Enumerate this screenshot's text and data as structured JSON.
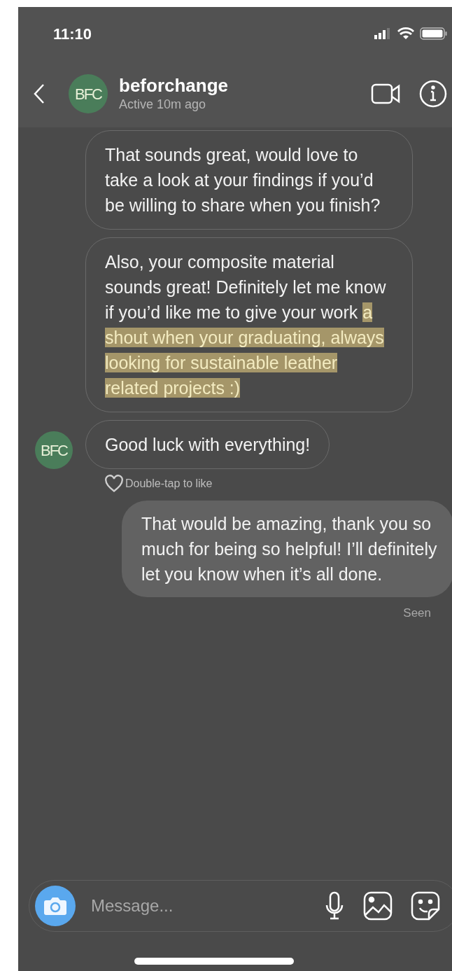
{
  "status_bar": {
    "time": "11:10"
  },
  "header": {
    "avatar_text": "BFC",
    "name": "beforchange",
    "status": "Active 10m ago"
  },
  "messages": [
    {
      "kind": "incoming",
      "segments": [
        {
          "text": "That sounds great, would love to take a look at your findings if you’d be willing to share when you finish?",
          "highlighted": false
        }
      ]
    },
    {
      "kind": "incoming",
      "segments": [
        {
          "text": "Also, your composite material sounds great! Definitely let me know if you’d like me to give your work ",
          "highlighted": false
        },
        {
          "text": "a shout when your graduating, always looking for sustainable leather related projects :) ",
          "highlighted": true
        }
      ]
    },
    {
      "kind": "incoming",
      "avatar_text": "BFC",
      "like_hint": "Double-tap to like",
      "segments": [
        {
          "text": "Good luck with everything!",
          "highlighted": false
        }
      ]
    },
    {
      "kind": "outgoing",
      "segments": [
        {
          "text": "That would be amazing, thank you so much for being so helpful! I’ll definitely let you know when it’s all done.",
          "highlighted": false
        }
      ]
    }
  ],
  "seen": "Seen",
  "composer": {
    "placeholder": "Message..."
  }
}
